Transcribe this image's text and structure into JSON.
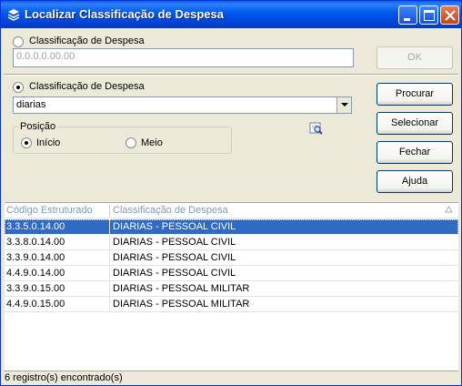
{
  "window": {
    "title": "Localizar Classificação de Despesa",
    "icons": {
      "app": "stack-icon",
      "minimize": "minimize-icon",
      "maximize": "maximize-icon",
      "close": "close-icon"
    }
  },
  "search_code": {
    "radio_label": "Classificação de Despesa",
    "selected": false,
    "field_value": "0.0.0.0.00.00",
    "ok_label": "OK"
  },
  "search_name": {
    "radio_label": "Classificação de Despesa",
    "selected": true,
    "combo_value": "diarias"
  },
  "position": {
    "group_label": "Posição",
    "options": [
      {
        "label": "Início",
        "selected": true
      },
      {
        "label": "Meio",
        "selected": false
      }
    ],
    "preview_icon": "magnifier-icon"
  },
  "buttons": {
    "search": "Procurar",
    "select": "Selecionar",
    "close": "Fechar",
    "help": "Ajuda"
  },
  "grid": {
    "columns": [
      "Código Estruturado",
      "Classificação de Despesa"
    ],
    "sort_indicator": "sort-ascending-icon",
    "rows": [
      {
        "code": "3.3.5.0.14.00",
        "name": "DIARIAS - PESSOAL CIVIL",
        "selected": true
      },
      {
        "code": "3.3.8.0.14.00",
        "name": "DIARIAS - PESSOAL CIVIL",
        "selected": false
      },
      {
        "code": "3.3.9.0.14.00",
        "name": "DIARIAS - PESSOAL CIVIL",
        "selected": false
      },
      {
        "code": "4.4.9.0.14.00",
        "name": "DIARIAS - PESSOAL CIVIL",
        "selected": false
      },
      {
        "code": "3.3.9.0.15.00",
        "name": "DIARIAS - PESSOAL MILITAR",
        "selected": false
      },
      {
        "code": "4.4.9.0.15.00",
        "name": "DIARIAS - PESSOAL MILITAR",
        "selected": false
      }
    ]
  },
  "status": {
    "text": "6 registro(s) encontrado(s)"
  },
  "colors": {
    "selection": "#316ac5",
    "titlebar": "#0058ee",
    "face": "#ece9d8"
  }
}
